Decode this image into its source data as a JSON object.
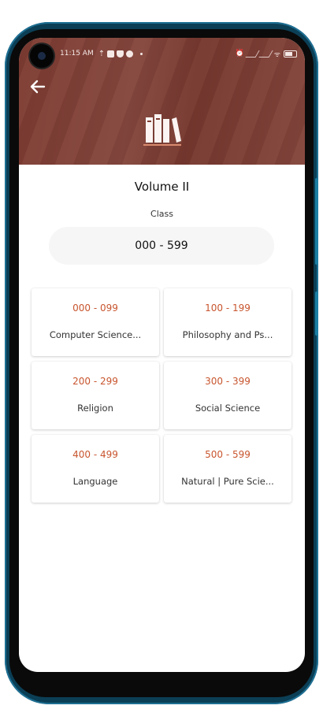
{
  "status_bar": {
    "time": "11:15 AM"
  },
  "header": {
    "back_icon": "arrow-left-icon",
    "logo_icon": "books-icon"
  },
  "volume": {
    "title": "Volume II"
  },
  "class_selector": {
    "label": "Class",
    "value": "000 - 599"
  },
  "categories": [
    {
      "range": "000 - 099",
      "name": "Computer Science..."
    },
    {
      "range": "100 - 199",
      "name": "Philosophy and Ps..."
    },
    {
      "range": "200 - 299",
      "name": "Religion"
    },
    {
      "range": "300 - 399",
      "name": "Social Science"
    },
    {
      "range": "400 - 499",
      "name": "Language"
    },
    {
      "range": "500 - 599",
      "name": "Natural | Pure Scie..."
    }
  ],
  "colors": {
    "header": "#7d3b31",
    "accent": "#c8552e",
    "frame": "#0b3f56"
  }
}
